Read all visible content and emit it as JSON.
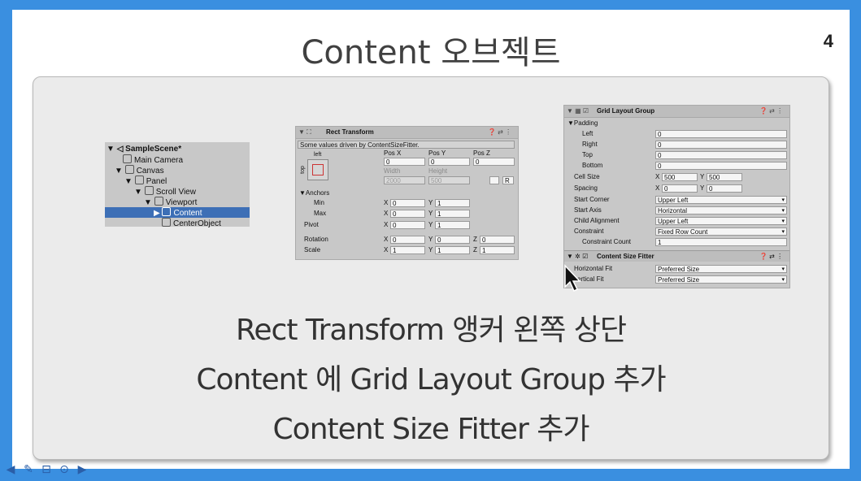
{
  "slide": {
    "title": "Content 오브젝트",
    "page_number": "4",
    "captions": [
      "Rect Transform 앵커 왼쪽 상단",
      "Content 에 Grid Layout Group 추가",
      "Content Size Fitter 추가"
    ]
  },
  "hierarchy": {
    "items": [
      "SampleScene*",
      "Main Camera",
      "Canvas",
      "Panel",
      "Scroll View",
      "Viewport",
      "Content",
      "CenterObject"
    ],
    "selected": "Content"
  },
  "rect_transform": {
    "title": "Rect Transform",
    "notice": "Some values driven by ContentSizeFitter.",
    "anchor_left": "left",
    "anchor_top": "top",
    "col_labels": [
      "Pos X",
      "Pos Y",
      "Pos Z"
    ],
    "pos": [
      "0",
      "0",
      "0"
    ],
    "width_label": "Width",
    "height_label": "Height",
    "width": "2000",
    "height": "500",
    "r_btn": "R",
    "anchors_label": "Anchors",
    "min_label": "Min",
    "max_label": "Max",
    "pivot_label": "Pivot",
    "rotation_label": "Rotation",
    "scale_label": "Scale",
    "min": [
      "0",
      "1"
    ],
    "max": [
      "0",
      "1"
    ],
    "pivot": [
      "0",
      "1"
    ],
    "rotation": [
      "0",
      "0",
      "0"
    ],
    "scale": [
      "1",
      "1",
      "1"
    ],
    "x": "X",
    "y": "Y",
    "z": "Z"
  },
  "grid_layout": {
    "title": "Grid Layout Group",
    "padding_label": "Padding",
    "left_label": "Left",
    "left": "0",
    "right_label": "Right",
    "right": "0",
    "top_label": "Top",
    "top": "0",
    "bottom_label": "Bottom",
    "bottom": "0",
    "cell_size_label": "Cell Size",
    "cell_x": "500",
    "cell_y": "500",
    "spacing_label": "Spacing",
    "spacing_x": "0",
    "spacing_y": "0",
    "start_corner_label": "Start Corner",
    "start_corner": "Upper Left",
    "start_axis_label": "Start Axis",
    "start_axis": "Horizontal",
    "child_alignment_label": "Child Alignment",
    "child_alignment": "Upper Left",
    "constraint_label": "Constraint",
    "constraint": "Fixed Row Count",
    "constraint_count_label": "Constraint Count",
    "constraint_count": "1"
  },
  "size_fitter": {
    "title": "Content Size Fitter",
    "horizontal_label": "Horizontal Fit",
    "horizontal": "Preferred Size",
    "vertical_label": "ertical Fit",
    "vertical": "Preferred Size"
  },
  "colors": {
    "background": "#3a8fe0",
    "selection": "#3d6fb6",
    "panel": "#ebebeb"
  }
}
